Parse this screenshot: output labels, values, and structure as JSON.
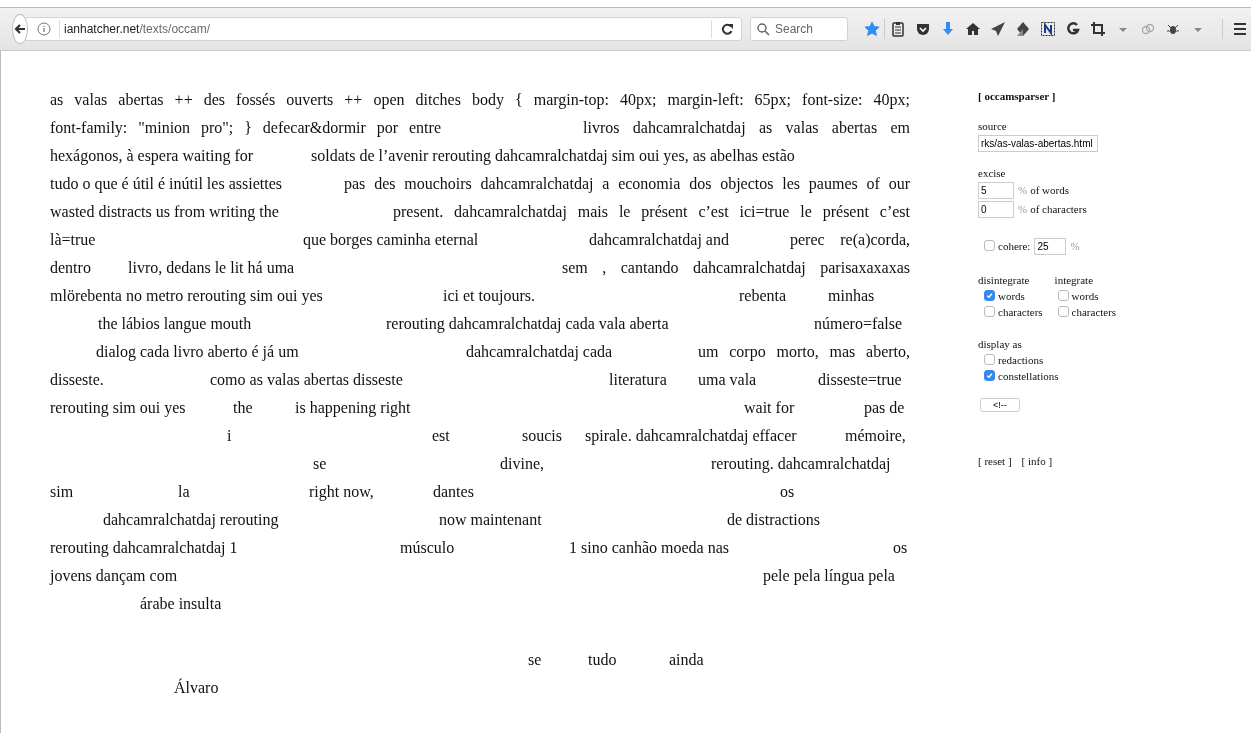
{
  "browser": {
    "url_host": "ianhatcher.net",
    "url_path": "/texts/occam/",
    "search_placeholder": "Search",
    "bookmarked": true
  },
  "text_lines": [
    [
      "as valas abertas ++ des fossés ouverts ++ open ditches body { margin-top: 40px; margin-left: 65px; font-size: 40px;"
    ],
    [
      "font-family: \"minion pro\"; } defecar&dormir por entre",
      "livros dahcamralchatdaj as valas abertas em"
    ],
    [
      "hexágonos, à espera waiting for",
      "soldats de l’avenir rerouting dahcamralchatdaj sim oui yes, as abelhas estão"
    ],
    [
      "tudo o que é útil é inútil les assiettes",
      "pas des mouchoirs dahcamralchatdaj a economia dos objectos les paumes of our"
    ],
    [
      "wasted distracts us from writing the",
      "present. dahcamralchatdaj mais le présent c’est ici=true le présent c’est"
    ],
    [
      "là=true",
      "que borges caminha eternal",
      "dahcamralchatdaj and",
      "perec re(a)corda,"
    ],
    [
      "dentro",
      "livro, dedans le lit há uma",
      "sem , cantando dahcamralchatdaj parisaxaxaxas"
    ],
    [
      "mlörebenta no metro rerouting sim oui yes",
      "ici et toujours.",
      "rebenta",
      "minhas"
    ],
    [
      "the lábios langue mouth",
      "rerouting dahcamralchatdaj cada vala aberta",
      "número=false"
    ],
    [
      "dialog cada livro aberto é já um",
      "dahcamralchatdaj cada",
      "um corpo morto, mas aberto,"
    ],
    [
      "disseste.",
      "como as valas abertas disseste",
      "literatura",
      "uma vala",
      "disseste=true"
    ],
    [
      "rerouting sim oui yes",
      "the",
      "is happening right",
      "wait for",
      "pas de"
    ],
    [
      "i",
      "est",
      "soucis",
      "spirale. dahcamralchatdaj effacer",
      "mémoire,"
    ],
    [
      "se",
      "divine,",
      "rerouting. dahcamralchatdaj"
    ],
    [
      "sim",
      "la",
      "right now,",
      "dantes",
      "os"
    ],
    [
      "dahcamralchatdaj rerouting",
      "now maintenant",
      "de distractions"
    ],
    [
      "rerouting dahcamralchatdaj 1",
      "músculo",
      "1 sino canhão moeda nas",
      "os"
    ],
    [
      "jovens dançam com",
      "pele pela língua pela"
    ],
    [
      "árabe insulta"
    ],
    [
      "se",
      "tudo",
      "ainda"
    ],
    [
      "Álvaro"
    ]
  ],
  "sidebar": {
    "title": "[ occamsparser ]",
    "source": {
      "label": "source",
      "value": "rks/as-valas-abertas.html"
    },
    "excise": {
      "label": "excise",
      "fields": [
        {
          "value": "5",
          "unit": "%",
          "label": "of words"
        },
        {
          "value": "0",
          "unit": "%",
          "label": "of characters"
        }
      ]
    },
    "cohere": {
      "label": "cohere:",
      "checked": false,
      "value": "25",
      "unit": "%"
    },
    "option_groups": [
      {
        "label": "disintegrate",
        "options": [
          {
            "label": "words",
            "checked": true
          },
          {
            "label": "characters",
            "checked": false
          }
        ]
      },
      {
        "label": "integrate",
        "options": [
          {
            "label": "words",
            "checked": false
          },
          {
            "label": "characters",
            "checked": false
          }
        ]
      }
    ],
    "display": {
      "label": "display as",
      "options": [
        {
          "label": "redactions",
          "checked": false
        },
        {
          "label": "constellations",
          "checked": true
        }
      ]
    },
    "button": "<!--",
    "links": [
      "[ reset ]",
      "[ info ]"
    ]
  }
}
